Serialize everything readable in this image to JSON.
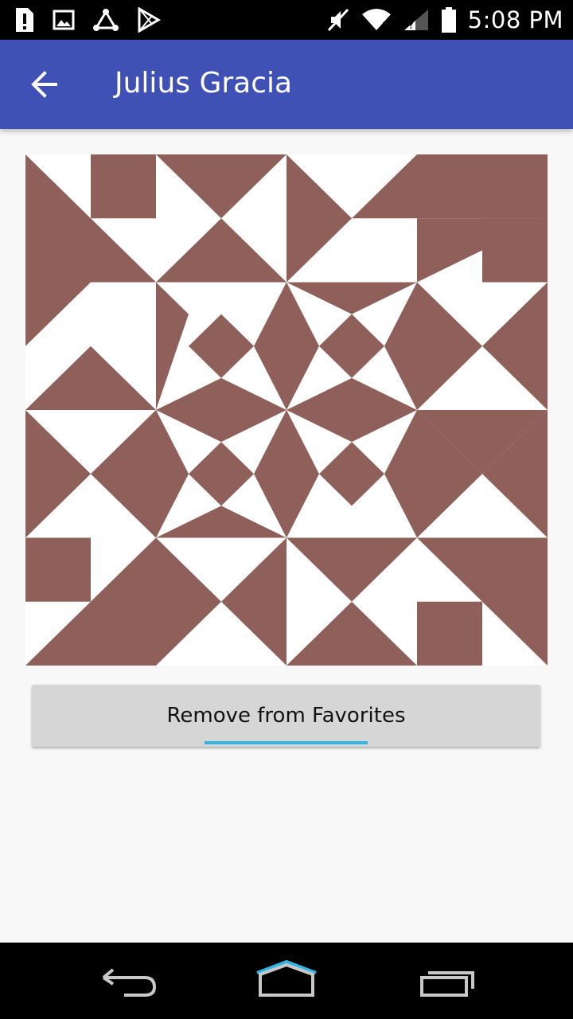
{
  "status_bar": {
    "time": "5:08 PM",
    "left_icons": [
      "alert-icon",
      "image-icon",
      "share-icon",
      "play-store-icon"
    ],
    "right_icons": [
      "mute-icon",
      "wifi-icon",
      "signal-icon",
      "battery-icon"
    ]
  },
  "app_bar": {
    "title": "Julius Gracia",
    "back_icon": "arrow-back-icon",
    "color": "#3f51b5"
  },
  "avatar": {
    "type": "identicon",
    "color": "#8f5f5a"
  },
  "actions": {
    "remove_label": "Remove from Favorites"
  },
  "nav_bar": {
    "icons": [
      "back-icon",
      "home-icon",
      "recent-apps-icon"
    ]
  }
}
